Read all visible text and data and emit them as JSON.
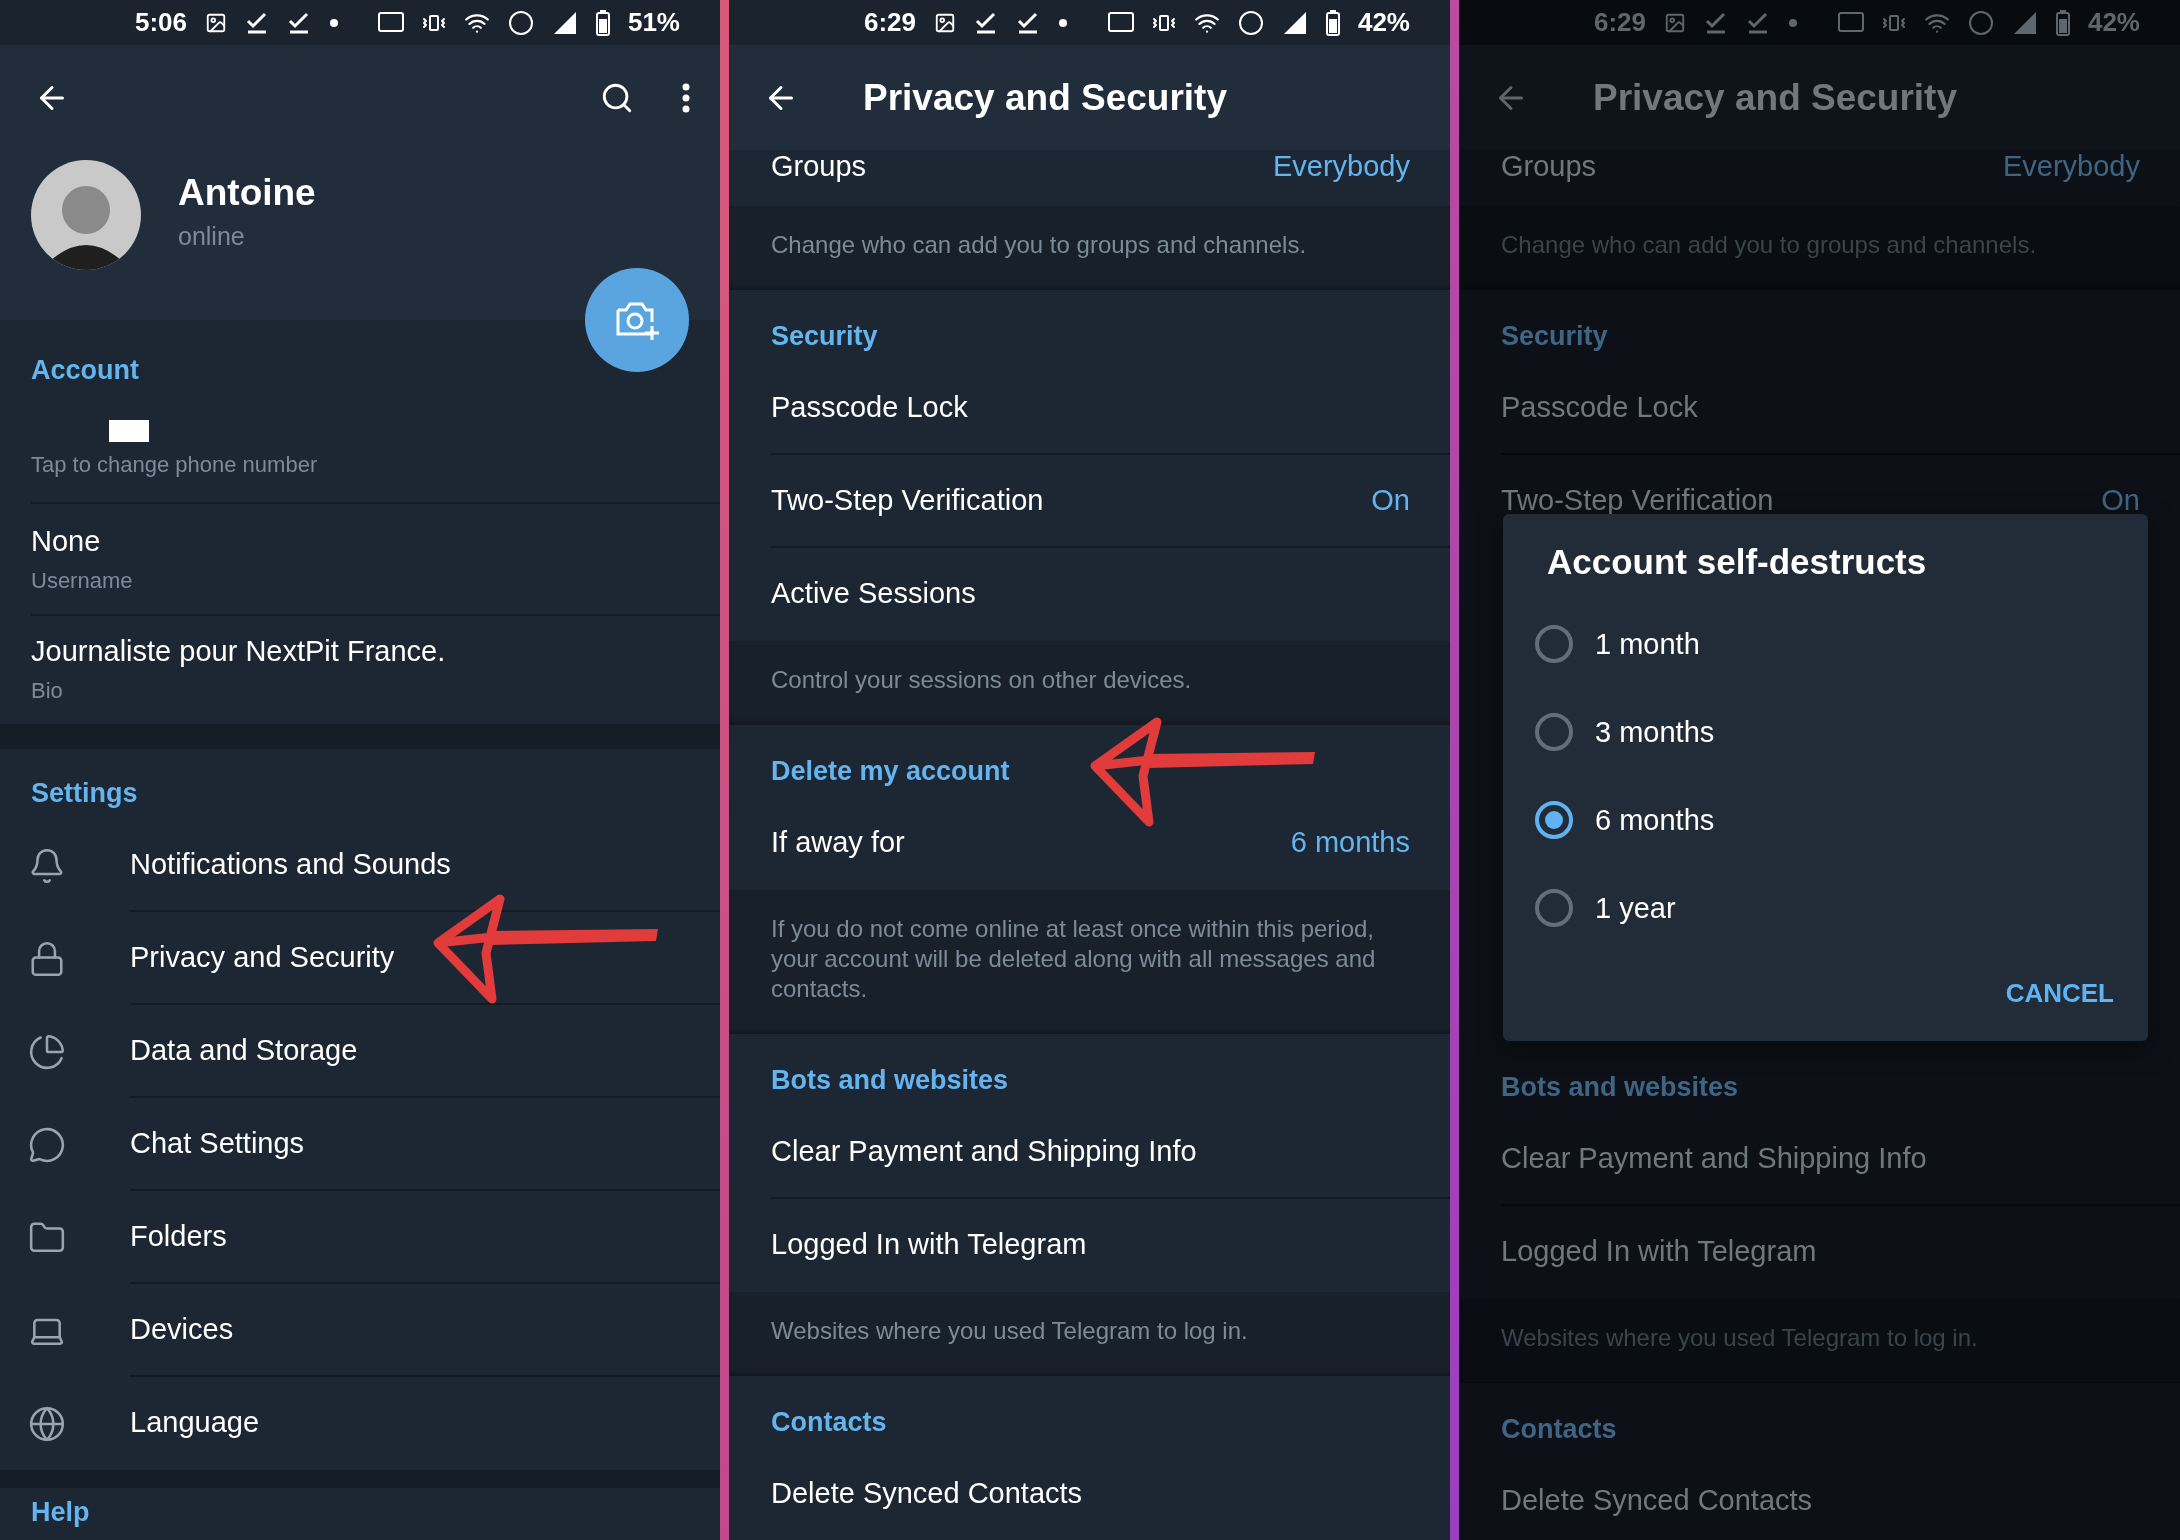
{
  "panels": [
    {
      "kind": "profile",
      "status_bar": {
        "time": "5:06",
        "battery": "51%"
      },
      "profile": {
        "name": "Antoine",
        "status": "online"
      },
      "account": {
        "header": "Account",
        "phone_hint": "Tap to change phone number",
        "username": "None",
        "username_label": "Username",
        "bio": "Journaliste pour NextPit France.",
        "bio_label": "Bio"
      },
      "settings": {
        "header": "Settings",
        "items": [
          {
            "label": "Notifications and Sounds"
          },
          {
            "label": "Privacy and Security"
          },
          {
            "label": "Data and Storage"
          },
          {
            "label": "Chat Settings"
          },
          {
            "label": "Folders"
          },
          {
            "label": "Devices"
          },
          {
            "label": "Language"
          }
        ]
      },
      "help_header": "Help"
    },
    {
      "kind": "privacy",
      "dimmed": false,
      "status_bar": {
        "time": "6:29",
        "battery": "42%"
      },
      "title": "Privacy and Security",
      "items": [
        {
          "kind": "row",
          "label": "Groups",
          "value": "Everybody"
        },
        {
          "kind": "hint",
          "text": "Change who can add you to groups and channels."
        },
        {
          "kind": "header",
          "text": "Security"
        },
        {
          "kind": "row",
          "label": "Passcode Lock"
        },
        {
          "kind": "row",
          "label": "Two-Step Verification",
          "value": "On"
        },
        {
          "kind": "row",
          "label": "Active Sessions"
        },
        {
          "kind": "hint",
          "text": "Control your sessions on other devices."
        },
        {
          "kind": "header",
          "text": "Delete my account"
        },
        {
          "kind": "row",
          "label": "If away for",
          "value": "6 months"
        },
        {
          "kind": "hint",
          "text": "If you do not come online at least once within this period, your account will be deleted along with all messages and contacts."
        },
        {
          "kind": "header",
          "text": "Bots and websites"
        },
        {
          "kind": "row",
          "label": "Clear Payment and Shipping Info"
        },
        {
          "kind": "row",
          "label": "Logged In with Telegram"
        },
        {
          "kind": "hint",
          "text": "Websites where you used Telegram to log in."
        },
        {
          "kind": "header",
          "text": "Contacts"
        },
        {
          "kind": "row",
          "label": "Delete Synced Contacts"
        }
      ]
    },
    {
      "kind": "privacy",
      "dimmed": true,
      "status_bar": {
        "time": "6:29",
        "battery": "42%"
      },
      "title": "Privacy and Security",
      "items": [
        {
          "kind": "row",
          "label": "Groups",
          "value": "Everybody"
        },
        {
          "kind": "hint",
          "text": "Change who can add you to groups and channels."
        },
        {
          "kind": "header",
          "text": "Security"
        },
        {
          "kind": "row",
          "label": "Passcode Lock"
        },
        {
          "kind": "row",
          "label": "Two-Step Verification",
          "value": "On"
        },
        {
          "kind": "dialog",
          "title": "Account self-destructs",
          "options": [
            {
              "label": "1 month",
              "selected": false
            },
            {
              "label": "3 months",
              "selected": false
            },
            {
              "label": "6 months",
              "selected": true
            },
            {
              "label": "1 year",
              "selected": false
            }
          ],
          "cancel": "CANCEL"
        },
        {
          "kind": "header",
          "text": "Bots and websites"
        },
        {
          "kind": "row",
          "label": "Clear Payment and Shipping Info"
        },
        {
          "kind": "row",
          "label": "Logged In with Telegram"
        },
        {
          "kind": "hint",
          "text": "Websites where you used Telegram to log in."
        },
        {
          "kind": "header",
          "text": "Contacts"
        },
        {
          "kind": "row",
          "label": "Delete Synced Contacts"
        }
      ]
    }
  ]
}
